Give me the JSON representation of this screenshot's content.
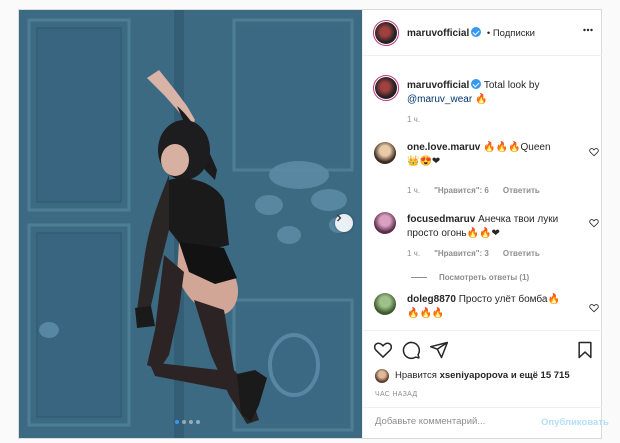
{
  "post": {
    "username": "maruvofficial",
    "follow_label": "• Подписки",
    "caption_text": "Total look by",
    "caption_mention": "@maruv_wear",
    "caption_emoji": "🔥",
    "caption_time": "1 ч."
  },
  "comments": [
    {
      "username": "one.love.maruv",
      "text": "🔥🔥🔥Queen",
      "text_line2": "👑😍❤",
      "time": "1 ч.",
      "likes": "\"Нравится\": 6",
      "reply": "Ответить"
    },
    {
      "username": "focusedmaruv",
      "text": "Анечка твои луки",
      "text_line2": "просто огонь🔥🔥❤",
      "time": "1 ч.",
      "likes": "\"Нравится\": 3",
      "reply": "Ответить",
      "view_replies": "Посмотреть ответы (1)"
    },
    {
      "username": "doleg8870",
      "text": "Просто улёт бомба🔥",
      "text_line2": "🔥🔥🔥"
    }
  ],
  "likes_line": {
    "prefix": "Нравится",
    "user": "xseniyapopova",
    "suffix": "и ещё 15 715"
  },
  "timestamp": "ЧАС НАЗАД",
  "comment_input": {
    "placeholder": "Добавьте комментарий...",
    "publish_label": "Опубликовать"
  },
  "carousel": {
    "count": 4,
    "active": 1
  },
  "icons": [
    "heart-icon",
    "comment-icon",
    "share-icon",
    "bookmark-icon",
    "next-arrow-icon",
    "verified-icon"
  ],
  "colors": {
    "accent": "#3897f0",
    "background_wall": "#3f6b84",
    "border": "#dbdbdb",
    "muted": "#8e8e8e",
    "publish_disabled": "#b2dffc"
  }
}
